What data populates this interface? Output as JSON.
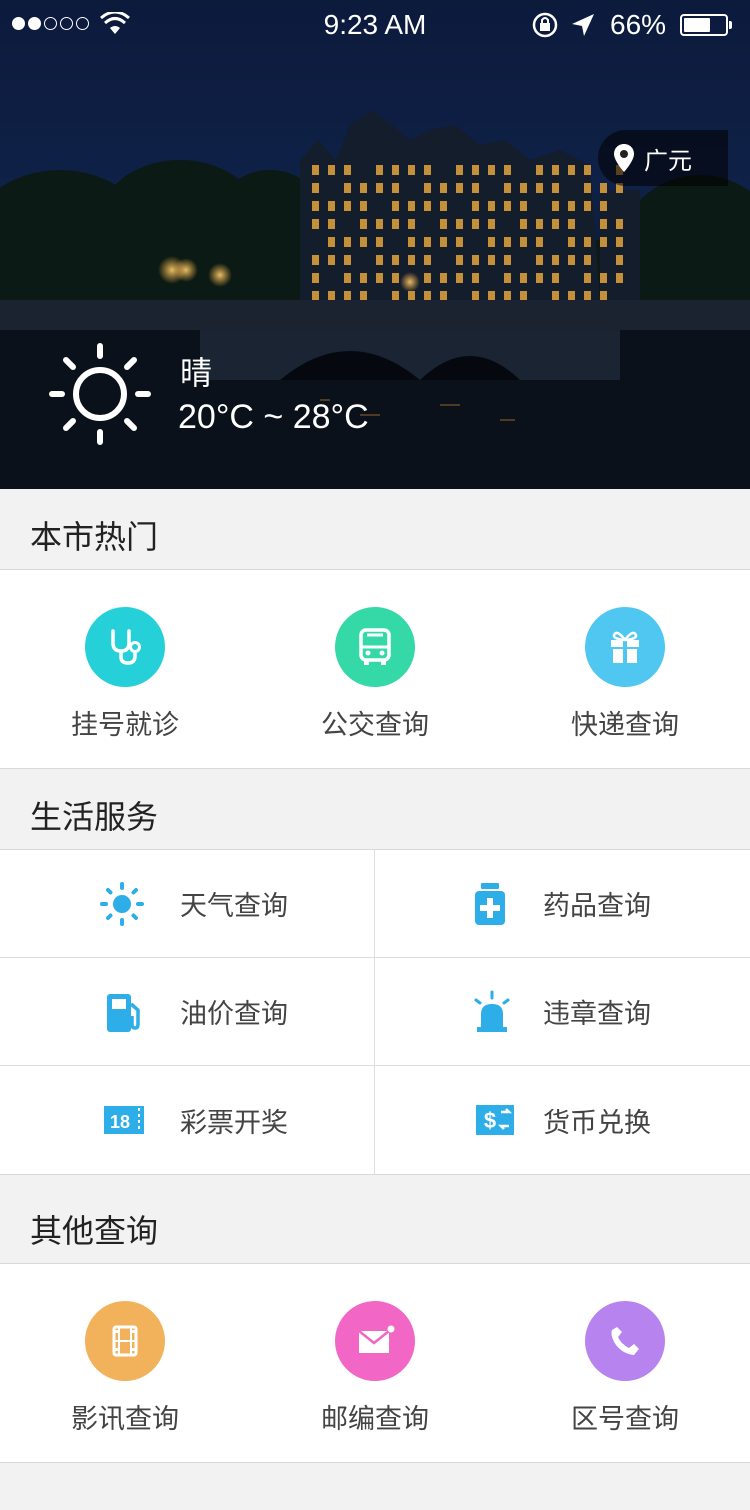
{
  "status_bar": {
    "time": "9:23 AM",
    "battery_percent_text": "66%",
    "battery_level": 0.66,
    "signal_bars_filled": 2,
    "signal_bars_total": 5
  },
  "location": {
    "city": "广元",
    "icon": "map-pin-icon"
  },
  "weather": {
    "condition": "晴",
    "temperature": "20°C ~ 28°C",
    "icon": "sun-icon"
  },
  "sections": {
    "hot": {
      "title": "本市热门",
      "items": [
        {
          "label": "挂号就诊",
          "icon": "stethoscope-icon",
          "color": "#26d0d8"
        },
        {
          "label": "公交查询",
          "icon": "bus-icon",
          "color": "#35d9a8"
        },
        {
          "label": "快递查询",
          "icon": "gift-icon",
          "color": "#4fc7f1"
        }
      ]
    },
    "life": {
      "title": "生活服务",
      "items": [
        {
          "label": "天气查询",
          "icon": "sun-icon"
        },
        {
          "label": "药品查询",
          "icon": "medicine-bottle-icon"
        },
        {
          "label": "油价查询",
          "icon": "fuel-pump-icon"
        },
        {
          "label": "违章查询",
          "icon": "siren-icon"
        },
        {
          "label": "彩票开奖",
          "icon": "lottery-ticket-icon"
        },
        {
          "label": "货币兑换",
          "icon": "currency-exchange-icon"
        }
      ],
      "icon_color": "#2eaee8",
      "lottery_number": "18"
    },
    "other": {
      "title": "其他查询",
      "items": [
        {
          "label": "影讯查询",
          "icon": "film-icon",
          "color": "#f2b25c"
        },
        {
          "label": "邮编查询",
          "icon": "mail-icon",
          "color": "#f266c6"
        },
        {
          "label": "区号查询",
          "icon": "phone-icon",
          "color": "#b783ef"
        }
      ]
    }
  }
}
